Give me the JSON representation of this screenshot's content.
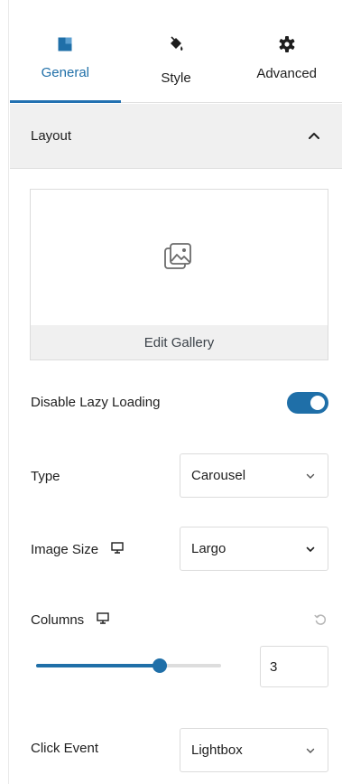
{
  "tabs": [
    {
      "label": "General",
      "icon": "layout-block-icon",
      "active": true
    },
    {
      "label": "Style",
      "icon": "paint-bucket-icon",
      "active": false
    },
    {
      "label": "Advanced",
      "icon": "gear-icon",
      "active": false
    }
  ],
  "section": {
    "title": "Layout",
    "icon": "chevron-up-icon",
    "expanded": true
  },
  "gallery": {
    "icon": "gallery-image-icon",
    "edit_label": "Edit Gallery"
  },
  "lazy_loading": {
    "label": "Disable Lazy Loading",
    "enabled": true
  },
  "type_field": {
    "label": "Type",
    "value": "Carousel"
  },
  "image_size_field": {
    "label": "Image Size",
    "device_icon": "desktop-icon",
    "value": "Largo"
  },
  "columns_field": {
    "label": "Columns",
    "device_icon": "desktop-icon",
    "reset_icon": "reset-icon",
    "value": "3",
    "slider_fraction": 0.67
  },
  "click_event_field": {
    "label": "Click Event",
    "value": "Lightbox"
  },
  "colors": {
    "accent": "#1f6fa8",
    "header_bg": "#f0f0f0",
    "border": "#dcdcdc"
  }
}
